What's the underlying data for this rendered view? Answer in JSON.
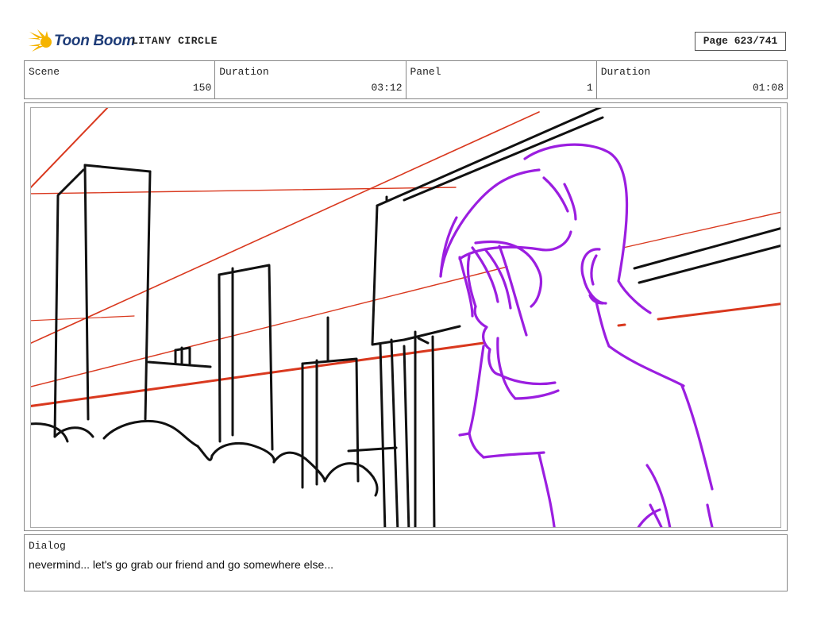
{
  "header": {
    "logo_text": "Toon Boom",
    "project_title": "LITANY CIRCLE",
    "page_label": "Page 623/741"
  },
  "info": [
    {
      "label": "Scene",
      "value": "150"
    },
    {
      "label": "Duration",
      "value": "03:12"
    },
    {
      "label": "Panel",
      "value": "1"
    },
    {
      "label": "Duration",
      "value": "01:08"
    }
  ],
  "dialog": {
    "label": "Dialog",
    "text": "nevermind... let's go grab our friend and go somewhere else..."
  },
  "colors": {
    "logo_text": "#1e3c78",
    "logo_star": "#f5b400",
    "guide_lines": "#d9381e",
    "background_ink": "#111111",
    "character_ink": "#9b1ee0"
  }
}
